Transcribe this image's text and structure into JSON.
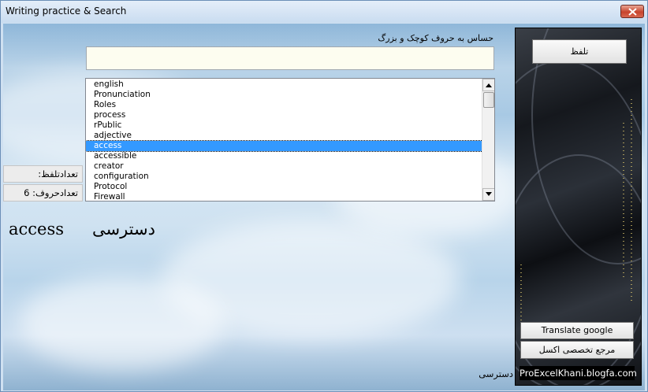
{
  "window": {
    "title": "Writing practice & Search"
  },
  "search": {
    "hint": "حساس به حروف کوچک و بزرگ",
    "value": ""
  },
  "word_list": {
    "items": [
      "english",
      "Pronunciation",
      "Roles",
      "process",
      "rPublic",
      "adjective",
      "access",
      "accessible",
      "creator",
      "configuration",
      "Protocol",
      "Firewall"
    ],
    "selected": "access"
  },
  "counts": {
    "pronounce_label": "تعدادتلفظ:",
    "pronounce_value": "",
    "letters_label": "تعدادحروف:",
    "letters_value": "6"
  },
  "current": {
    "word": "access",
    "translation": "دسترسی"
  },
  "buttons": {
    "pronounce": "تلفظ",
    "translate_google": "Translate google",
    "excel_reference": "مرجع تخصصی اکسل"
  },
  "footer": {
    "brand": "ProExcelKhani.blogfa.com",
    "word": "دسترسی"
  },
  "icons": {
    "close": "close-icon",
    "scroll_up": "arrow-up-icon",
    "scroll_down": "arrow-down-icon"
  },
  "colors": {
    "selection": "#3399ff",
    "close_button": "#c7442d",
    "input_background": "#fdfdf0"
  }
}
